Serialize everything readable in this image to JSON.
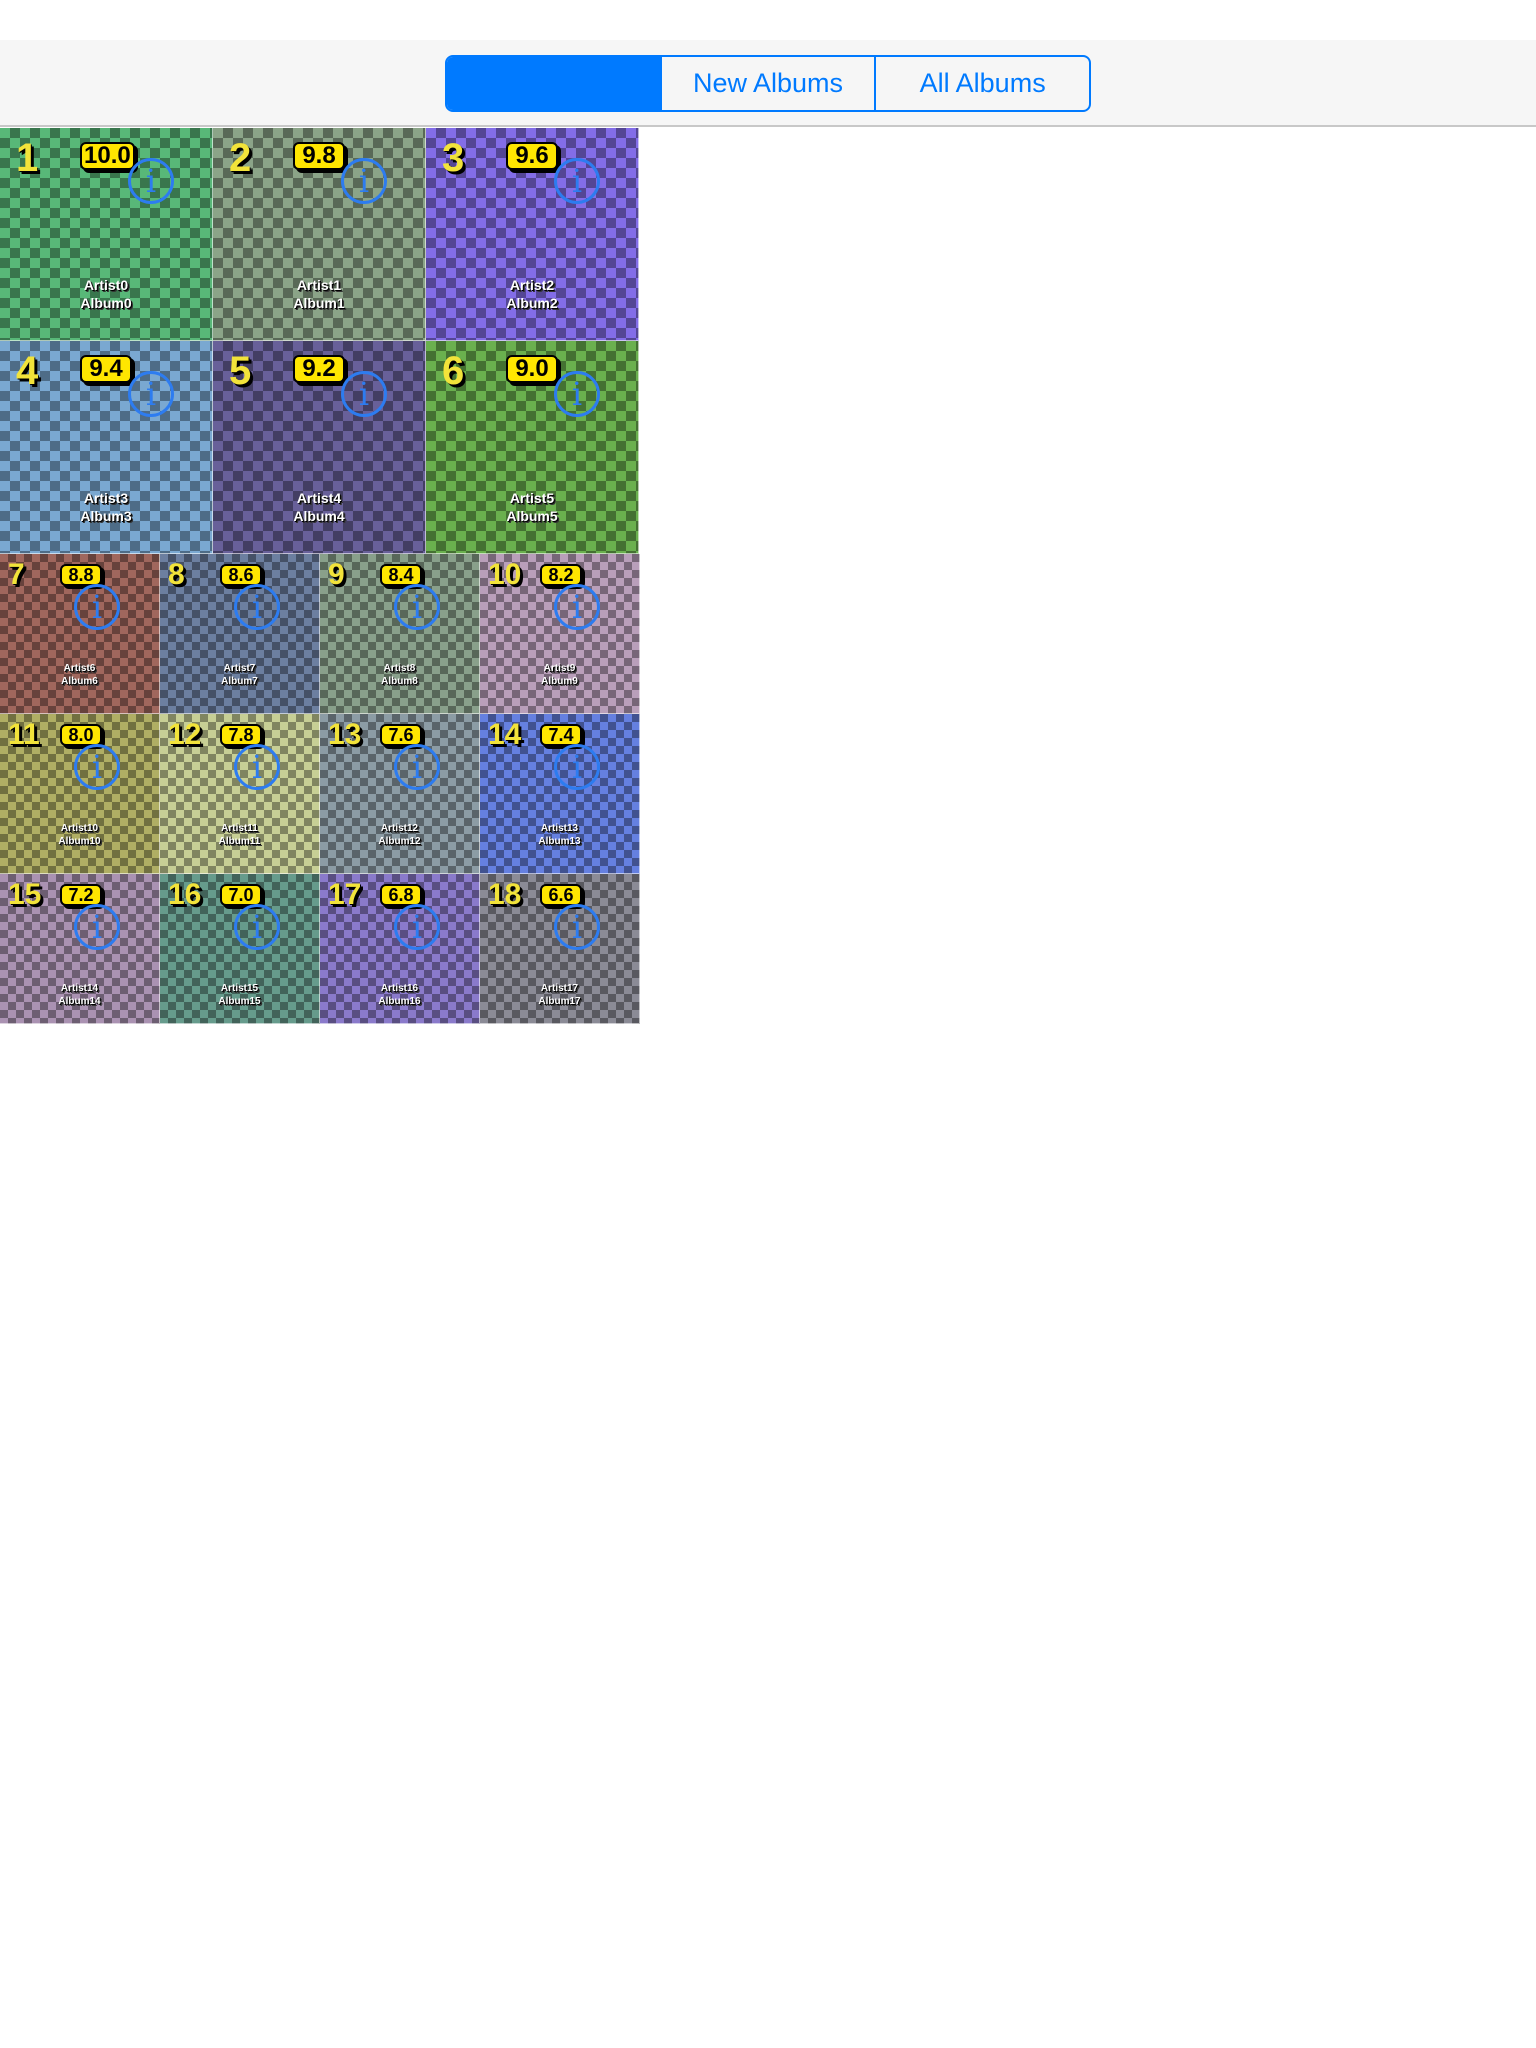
{
  "segmented_control": {
    "segments": [
      {
        "label": "",
        "selected": true
      },
      {
        "label": "New Albums",
        "selected": false
      },
      {
        "label": "All Albums",
        "selected": false
      }
    ],
    "accent_color": "#007aff"
  },
  "albums": [
    {
      "rank": "1",
      "score": "10.0",
      "artist": "Artist0",
      "album": "Album0",
      "color": "#4fa46b"
    },
    {
      "rank": "2",
      "score": "9.8",
      "artist": "Artist1",
      "album": "Album1",
      "color": "#7c9279"
    },
    {
      "rank": "3",
      "score": "9.6",
      "artist": "Artist2",
      "album": "Album2",
      "color": "#7561cf"
    },
    {
      "rank": "4",
      "score": "9.4",
      "artist": "Artist3",
      "album": "Album3",
      "color": "#6d96bb"
    },
    {
      "rank": "5",
      "score": "9.2",
      "artist": "Artist4",
      "album": "Album4",
      "color": "#5d5689"
    },
    {
      "rank": "6",
      "score": "9.0",
      "artist": "Artist5",
      "album": "Album5",
      "color": "#5f9d46"
    },
    {
      "rank": "7",
      "score": "8.8",
      "artist": "Artist6",
      "album": "Album6",
      "color": "#8f5c53"
    },
    {
      "rank": "8",
      "score": "8.6",
      "artist": "Artist7",
      "album": "Album7",
      "color": "#60718f"
    },
    {
      "rank": "9",
      "score": "8.4",
      "artist": "Artist8",
      "album": "Album8",
      "color": "#7a8f7c"
    },
    {
      "rank": "10",
      "score": "8.2",
      "artist": "Artist9",
      "album": "Album9",
      "color": "#a58ea6"
    },
    {
      "rank": "11",
      "score": "8.0",
      "artist": "Artist10",
      "album": "Album10",
      "color": "#9d9b59"
    },
    {
      "rank": "12",
      "score": "7.8",
      "artist": "Artist11",
      "album": "Album11",
      "color": "#b2b985"
    },
    {
      "rank": "13",
      "score": "7.6",
      "artist": "Artist12",
      "album": "Album12",
      "color": "#7d8b93"
    },
    {
      "rank": "14",
      "score": "7.4",
      "artist": "Artist13",
      "album": "Album13",
      "color": "#5a72c8"
    },
    {
      "rank": "15",
      "score": "7.2",
      "artist": "Artist14",
      "album": "Album14",
      "color": "#98829f"
    },
    {
      "rank": "16",
      "score": "7.0",
      "artist": "Artist15",
      "album": "Album15",
      "color": "#5b8a7d"
    },
    {
      "rank": "17",
      "score": "6.8",
      "artist": "Artist16",
      "album": "Album16",
      "color": "#7b6db5"
    },
    {
      "rank": "18",
      "score": "6.6",
      "artist": "Artist17",
      "album": "Album17",
      "color": "#7c7c86"
    }
  ]
}
